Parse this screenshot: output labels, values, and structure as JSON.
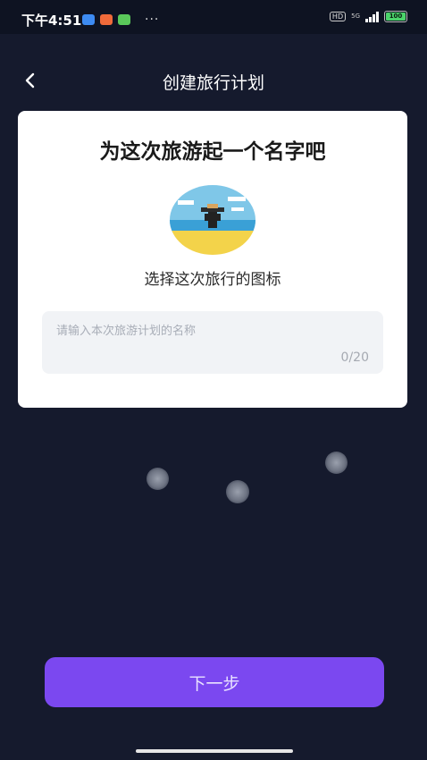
{
  "status_bar": {
    "time": "下午4:51",
    "left_icons": [
      "notification-blue-icon",
      "notification-orange-icon",
      "notification-green-icon"
    ],
    "more": "···",
    "hd": "HD",
    "network": "5G",
    "battery": "100"
  },
  "header": {
    "title": "创建旅行计划"
  },
  "card": {
    "title": "为这次旅游起一个名字吧",
    "choose_icon_label": "选择这次旅行的图标",
    "name_input": {
      "value": "",
      "placeholder": "请输入本次旅游计划的名称"
    },
    "char_count": "0/20"
  },
  "next_button": {
    "label": "下一步"
  },
  "colors": {
    "background": "#151a2d",
    "accent": "#7b48f0",
    "card": "#ffffff"
  }
}
